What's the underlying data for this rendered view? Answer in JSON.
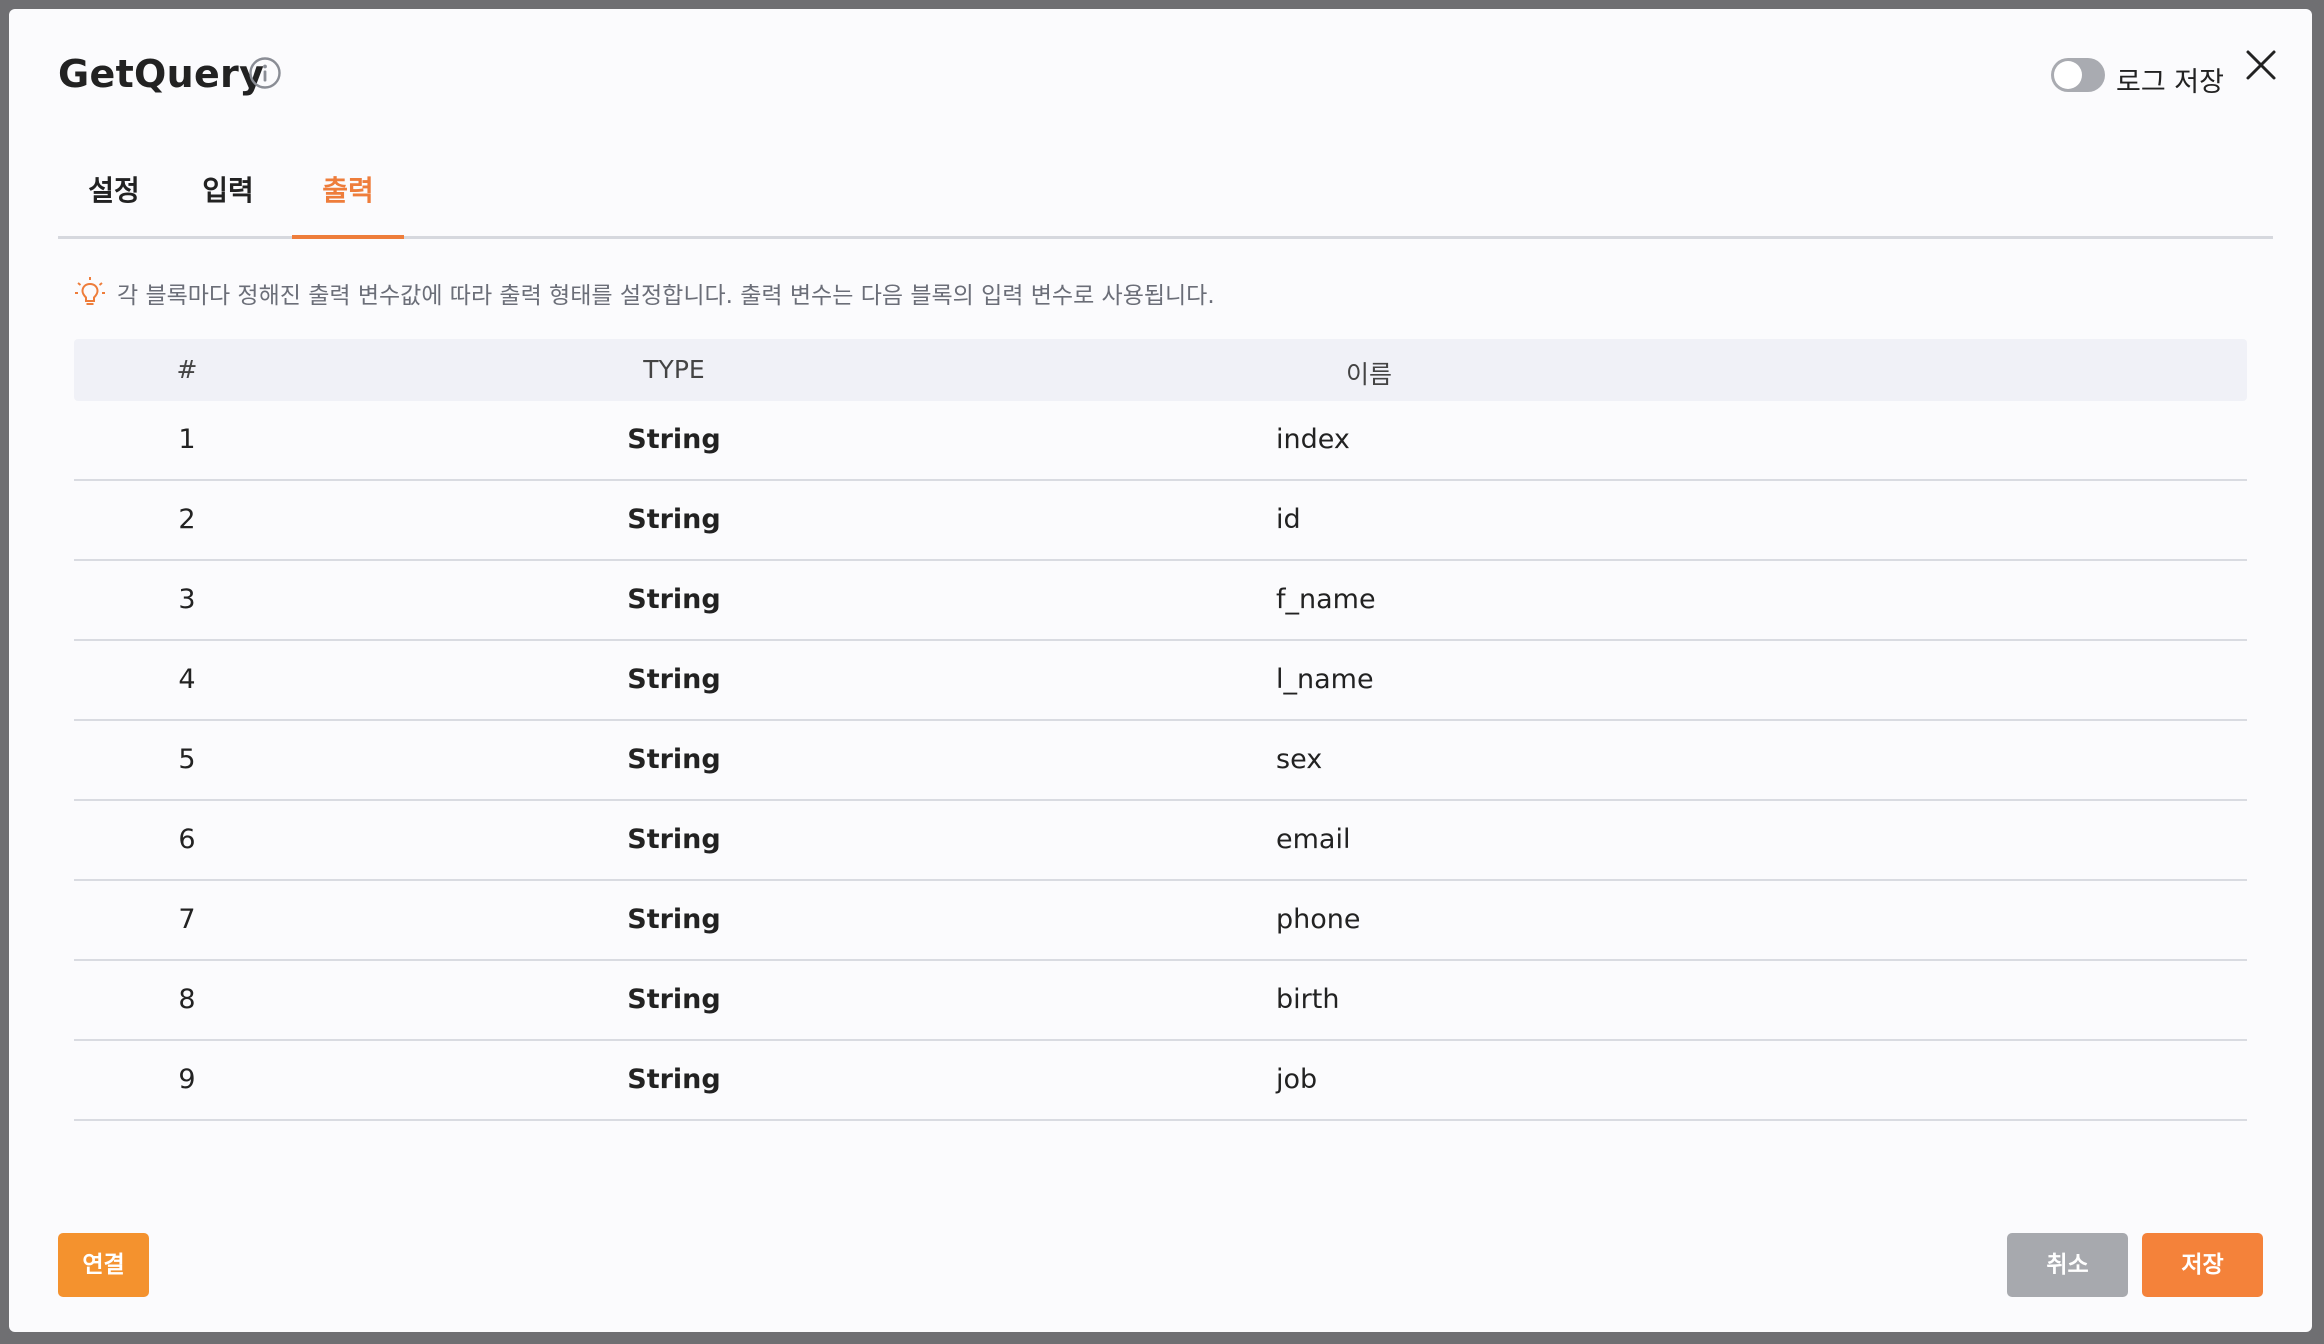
{
  "dialog": {
    "title": "GetQuery",
    "log_toggle_label": "로그 저장",
    "log_toggle_on": false
  },
  "tabs": [
    {
      "label": "설정",
      "active": false
    },
    {
      "label": "입력",
      "active": false
    },
    {
      "label": "출력",
      "active": true
    }
  ],
  "notice": {
    "icon": "lightbulb-icon",
    "text": "각 블록마다 정해진 출력 변수값에 따라 출력 형태를 설정합니다. 출력 변수는 다음 블록의 입력 변수로 사용됩니다."
  },
  "table": {
    "headers": {
      "num": "#",
      "type": "TYPE",
      "name": "이름"
    },
    "rows": [
      {
        "num": "1",
        "type": "String",
        "name": "index"
      },
      {
        "num": "2",
        "type": "String",
        "name": "id"
      },
      {
        "num": "3",
        "type": "String",
        "name": "f_name"
      },
      {
        "num": "4",
        "type": "String",
        "name": "l_name"
      },
      {
        "num": "5",
        "type": "String",
        "name": "sex"
      },
      {
        "num": "6",
        "type": "String",
        "name": "email"
      },
      {
        "num": "7",
        "type": "String",
        "name": "phone"
      },
      {
        "num": "8",
        "type": "String",
        "name": "birth"
      },
      {
        "num": "9",
        "type": "String",
        "name": "job"
      }
    ]
  },
  "footer": {
    "connect_label": "연결",
    "cancel_label": "취소",
    "save_label": "저장"
  },
  "colors": {
    "accent": "#ee7d3b",
    "connect_button": "#f4922e",
    "save_button": "#f4823a",
    "cancel_button": "#a7a9ae"
  }
}
